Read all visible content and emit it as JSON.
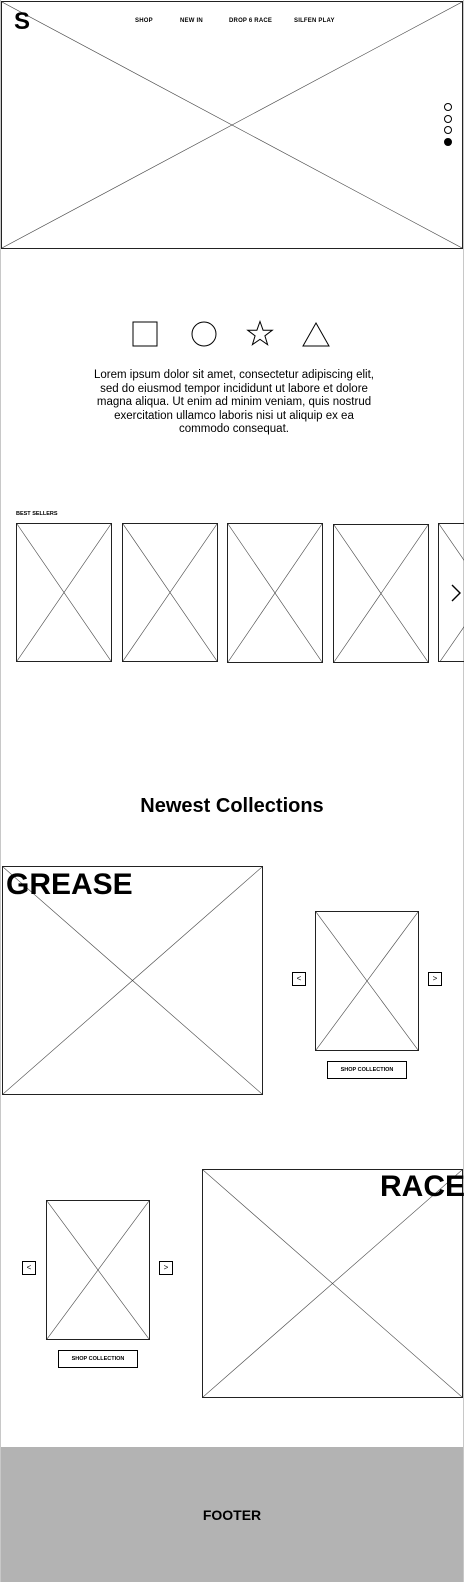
{
  "header": {
    "logo": "S",
    "nav": [
      "SHOP",
      "NEW IN",
      "DROP 6 RACE",
      "SILFEN PLAY"
    ],
    "carousel_dots": {
      "count": 4,
      "active_index": 3
    }
  },
  "features": {
    "icons": [
      "square-icon",
      "circle-icon",
      "star-icon",
      "triangle-icon"
    ],
    "text": "Lorem ipsum dolor sit amet, consectetur adipiscing elit, sed do eiusmod tempor incididunt ut labore et dolore magna aliqua. Ut enim ad minim veniam, quis nostrud exercitation ullamco laboris nisi ut aliquip ex ea commodo consequat."
  },
  "best_sellers": {
    "label": "BEST SELLERS",
    "next_icon": "chevron-right-icon"
  },
  "collections": {
    "title": "Newest Collections",
    "items": [
      {
        "label": "GREASE",
        "prev": "<",
        "next": ">",
        "button": "SHOP COLLECTION"
      },
      {
        "label": "RACE",
        "prev": "<",
        "next": ">",
        "button": "SHOP COLLECTION"
      }
    ]
  },
  "footer": {
    "label": "FOOTER"
  }
}
